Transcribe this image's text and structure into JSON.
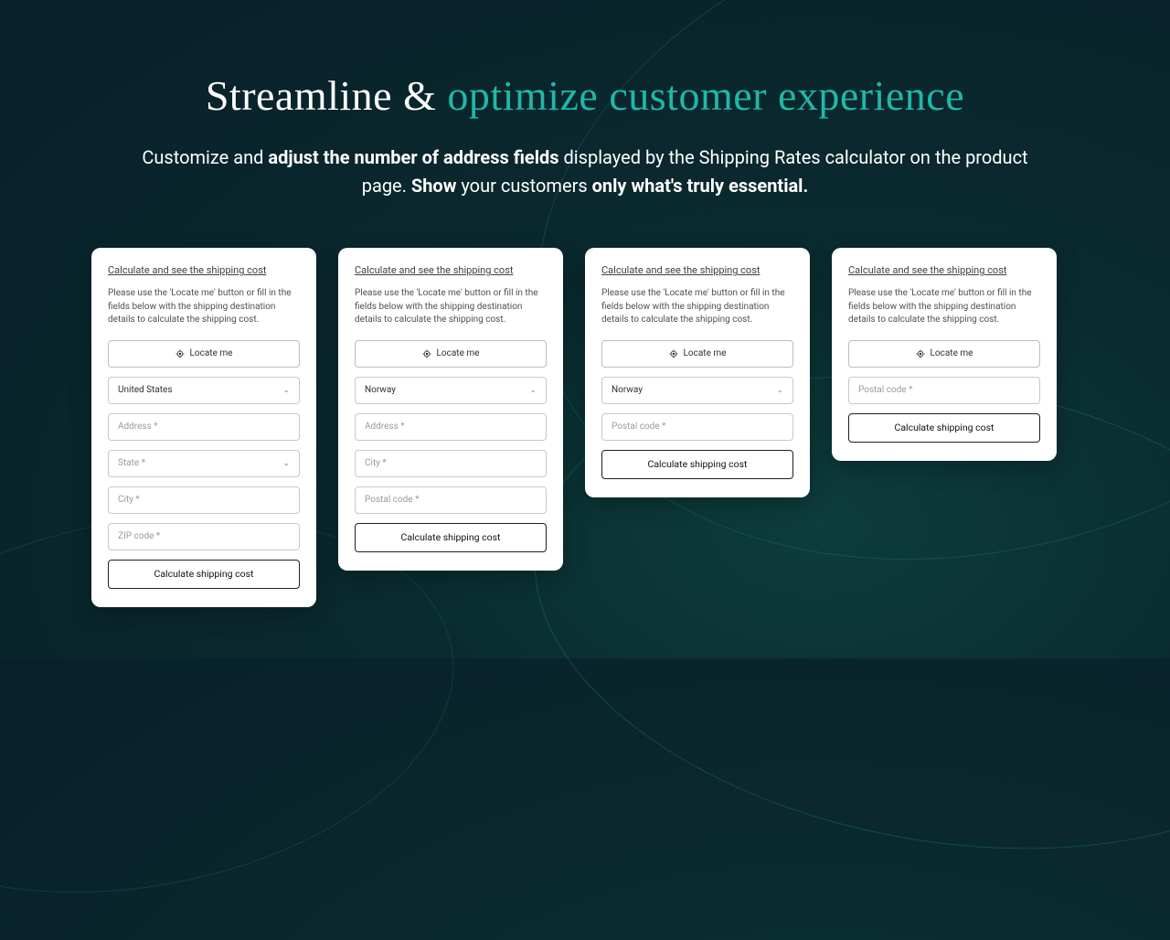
{
  "hero": {
    "headline_part1": "Streamline & ",
    "headline_part2": "optimize customer experience",
    "sub_1": "Customize and ",
    "sub_bold_1": "adjust the number of address fields",
    "sub_2": " displayed by the Shipping Rates calculator on the product page. ",
    "sub_bold_2": "Show",
    "sub_3": " your customers ",
    "sub_bold_3": "only what's truly essential."
  },
  "common": {
    "card_title": "Calculate and see the shipping cost",
    "card_desc": "Please use the 'Locate me' button or fill in the fields below with the shipping destination details to calculate the shipping cost.",
    "locate_label": "Locate me",
    "calc_label": "Calculate shipping cost"
  },
  "cards": {
    "c1": {
      "country": "United States",
      "address_ph": "Address *",
      "state_ph": "State *",
      "city_ph": "City *",
      "zip_ph": "ZIP code *"
    },
    "c2": {
      "country": "Norway",
      "address_ph": "Address *",
      "city_ph": "City *",
      "postal_ph": "Postal code *"
    },
    "c3": {
      "country": "Norway",
      "postal_ph": "Postal code *"
    },
    "c4": {
      "postal_ph": "Postal code *"
    }
  }
}
